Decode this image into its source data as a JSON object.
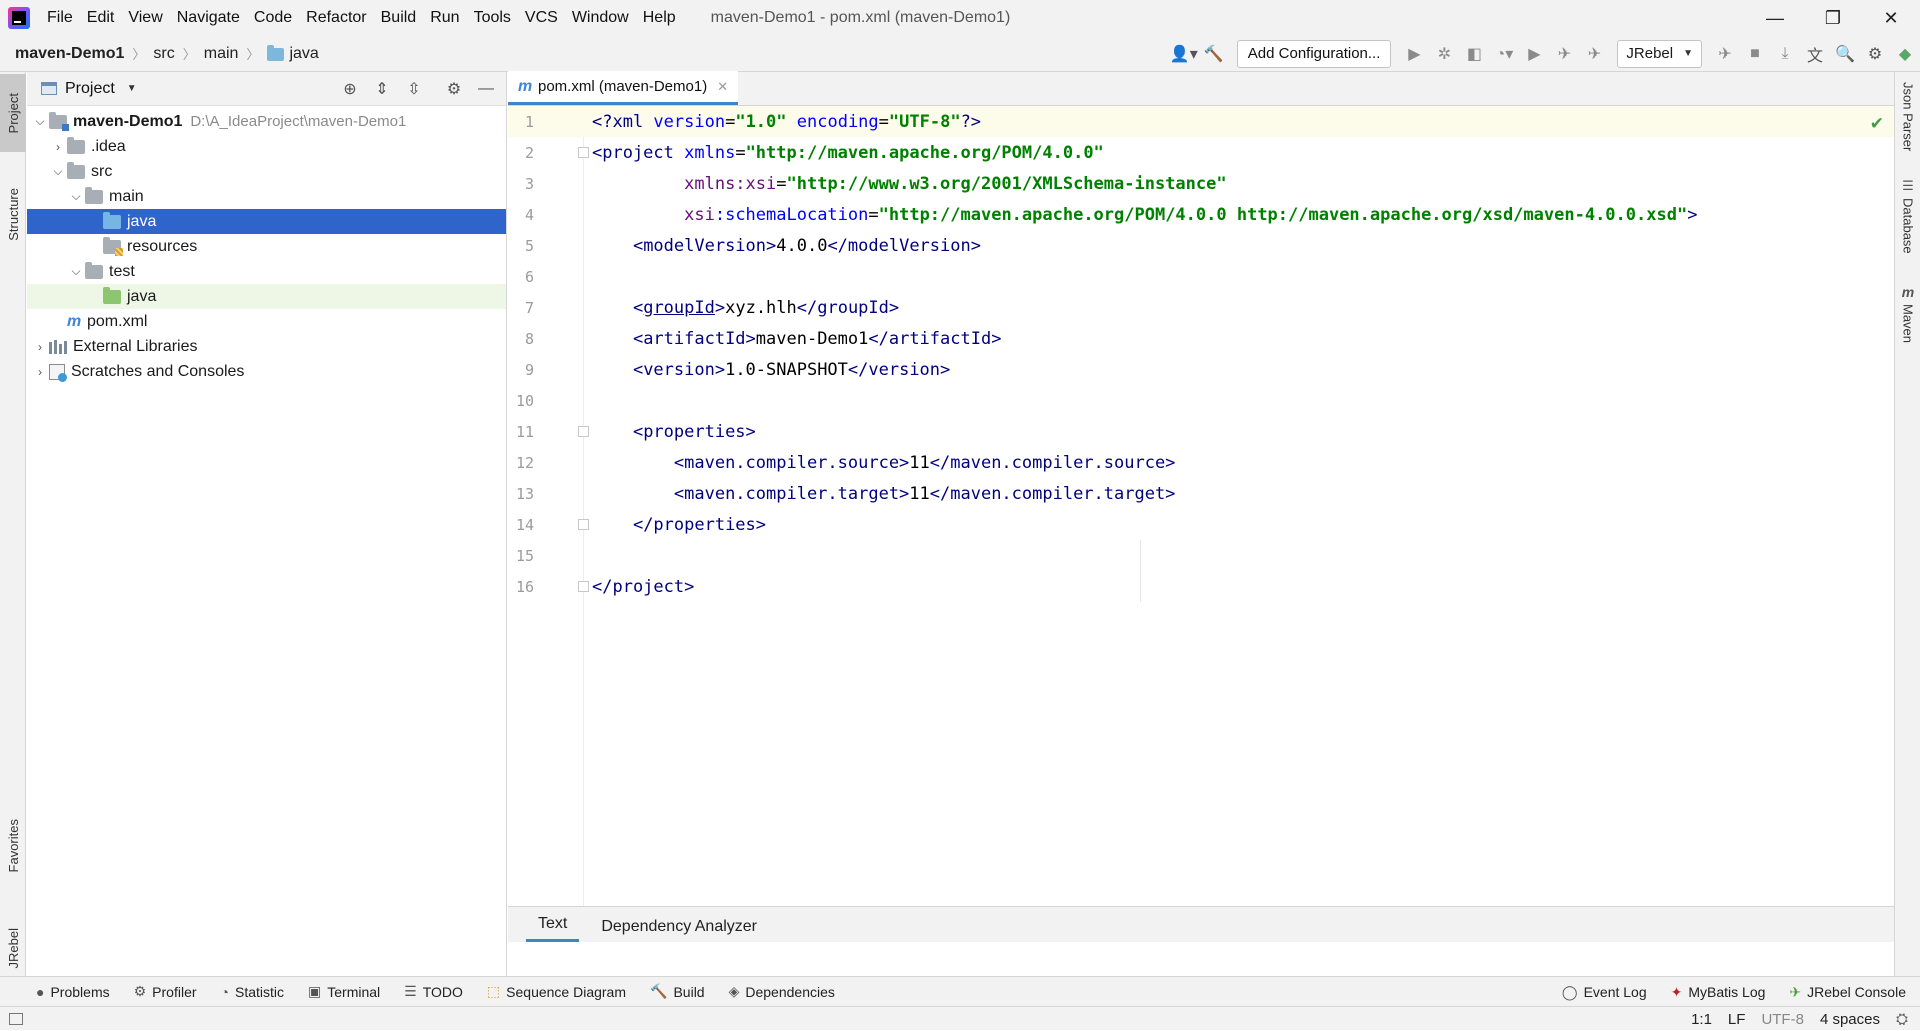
{
  "window": {
    "title": "maven-Demo1 - pom.xml (maven-Demo1)",
    "minimize": "—",
    "restore": "❐",
    "close": "✕"
  },
  "menu": [
    "File",
    "Edit",
    "View",
    "Navigate",
    "Code",
    "Refactor",
    "Build",
    "Run",
    "Tools",
    "VCS",
    "Window",
    "Help"
  ],
  "breadcrumb": [
    "maven-Demo1",
    "src",
    "main",
    "java"
  ],
  "toolbar": {
    "add_config_label": "Add Configuration...",
    "jrebel_label": "JRebel"
  },
  "left_stripe": {
    "project": "Project",
    "structure": "Structure",
    "favorites": "Favorites",
    "jrebel": "JRebel"
  },
  "right_stripe": {
    "json_parser": "Json Parser",
    "database": "Database",
    "maven": "Maven"
  },
  "project_panel": {
    "title": "Project",
    "tree": [
      {
        "label": "maven-Demo1",
        "hint": "D:\\A_IdeaProject\\maven-Demo1"
      },
      {
        "label": ".idea"
      },
      {
        "label": "src"
      },
      {
        "label": "main"
      },
      {
        "label": "java"
      },
      {
        "label": "resources"
      },
      {
        "label": "test"
      },
      {
        "label": "java"
      },
      {
        "label": "pom.xml"
      },
      {
        "label": "External Libraries"
      },
      {
        "label": "Scratches and Consoles"
      }
    ]
  },
  "editor": {
    "tab_label": "pom.xml (maven-Demo1)",
    "line_numbers": [
      "1",
      "2",
      "3",
      "4",
      "5",
      "6",
      "7",
      "8",
      "9",
      "10",
      "11",
      "12",
      "13",
      "14",
      "15",
      "16"
    ],
    "code": {
      "l1_pi_open": "<?xml ",
      "l1_a1": "version",
      "l1_v1": "\"1.0\"",
      "l1_a2": "encoding",
      "l1_v2": "\"UTF-8\"",
      "l1_pi_close": "?>",
      "l2_tag": "<project ",
      "l2_attr": "xmlns",
      "l2_val": "\"http://maven.apache.org/POM/4.0.0\"",
      "l3_ns": "xmlns:xsi",
      "l3_val": "\"http://www.w3.org/2001/XMLSchema-instance\"",
      "l4_ns": "xsi",
      "l4_attr": ":schemaLocation",
      "l4_val": "\"http://maven.apache.org/POM/4.0.0 http://maven.apache.org/xsd/maven-4.0.0.xsd\"",
      "l4_close": ">",
      "l5_open": "<modelVersion>",
      "l5_text": "4.0.0",
      "l5_close": "</modelVersion>",
      "l7_lt": "<",
      "l7_name": "groupId",
      "l7_gt": ">",
      "l7_text": "xyz.hlh",
      "l7_close": "</groupId>",
      "l8_open": "<artifactId>",
      "l8_text": "maven-Demo1",
      "l8_close": "</artifactId>",
      "l9_open": "<version>",
      "l9_text": "1.0-SNAPSHOT",
      "l9_close": "</version>",
      "l11_open": "<properties>",
      "l12_open": "<maven.compiler.source>",
      "l12_text": "11",
      "l12_close": "</maven.compiler.source>",
      "l13_open": "<maven.compiler.target>",
      "l13_text": "11",
      "l13_close": "</maven.compiler.target>",
      "l14_close": "</properties>",
      "l16_close": "</project>"
    },
    "bottom_tabs": [
      "Text",
      "Dependency Analyzer"
    ]
  },
  "tool_windows": {
    "left": [
      "Problems",
      "Profiler",
      "Statistic",
      "Terminal",
      "TODO",
      "Sequence Diagram",
      "Build",
      "Dependencies"
    ],
    "right": [
      "Event Log",
      "MyBatis Log",
      "JRebel Console"
    ]
  },
  "status": {
    "position": "1:1",
    "line_sep": "LF",
    "encoding": "UTF-8",
    "indent": "4 spaces"
  }
}
